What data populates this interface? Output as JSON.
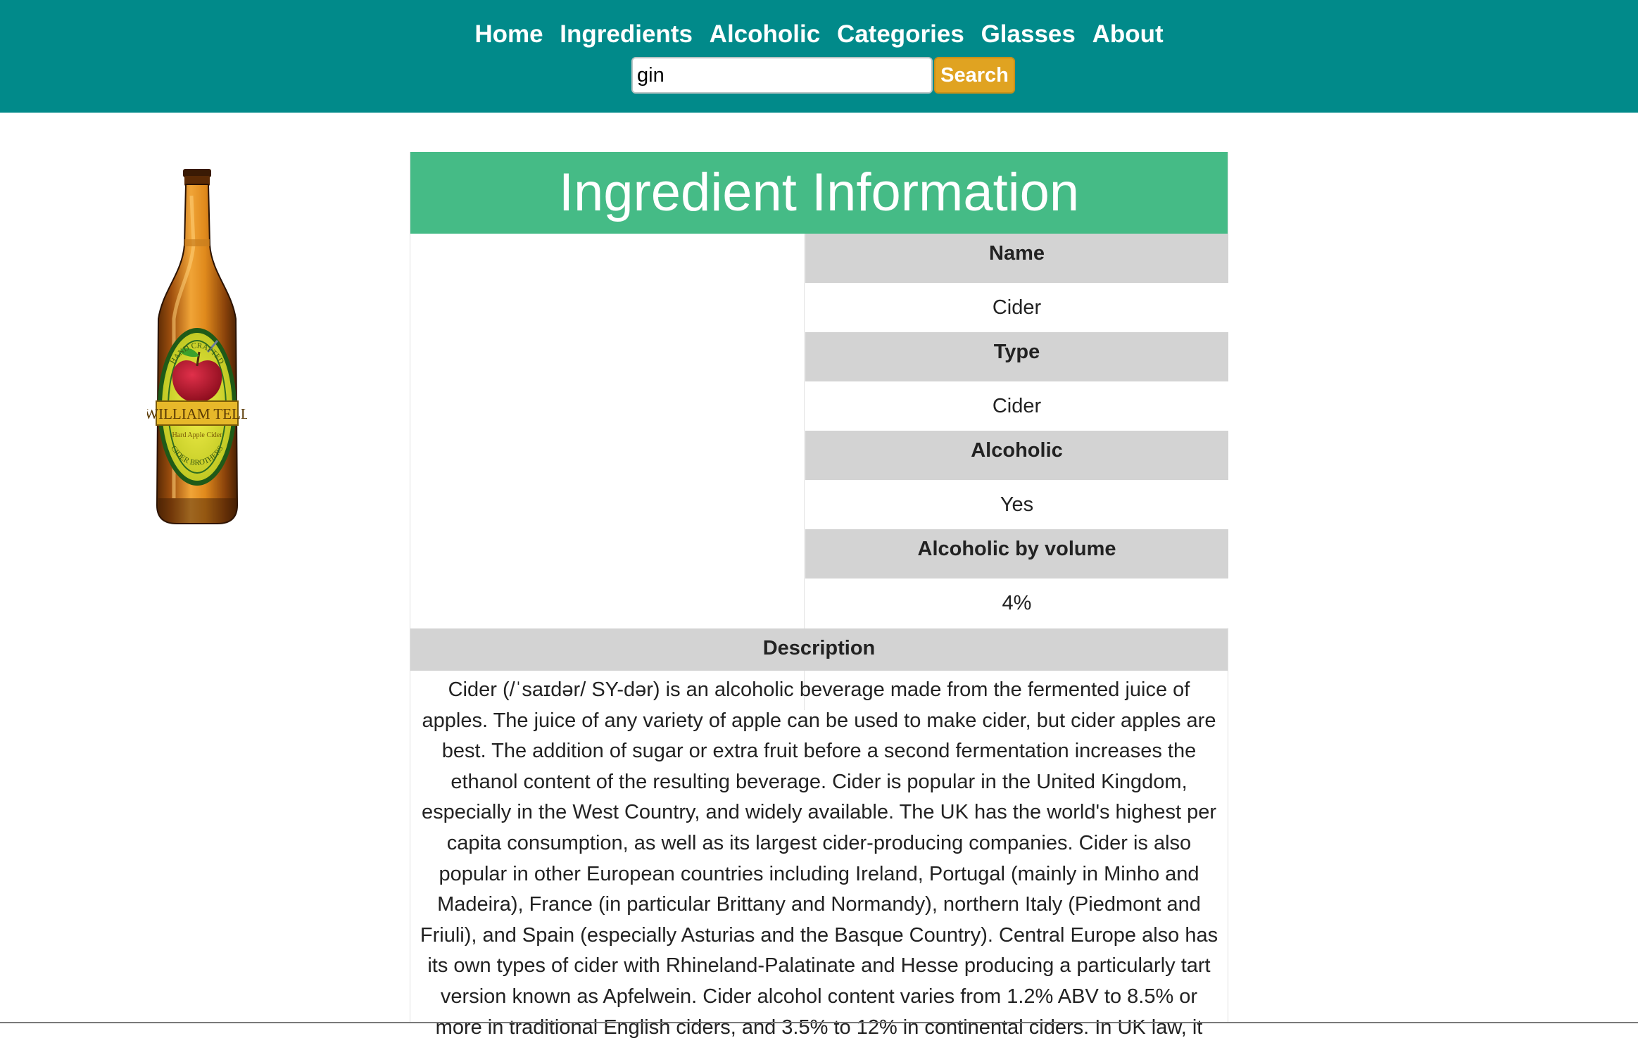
{
  "nav": {
    "items": [
      {
        "label": "Home"
      },
      {
        "label": "Ingredients"
      },
      {
        "label": "Alcoholic"
      },
      {
        "label": "Categories"
      },
      {
        "label": "Glasses"
      },
      {
        "label": "About"
      }
    ]
  },
  "search": {
    "value": "gin",
    "button_label": "Search"
  },
  "panel": {
    "title": "Ingredient Information",
    "image_icon": "cider-bottle-image",
    "fields": [
      {
        "label": "Name",
        "value": "Cider"
      },
      {
        "label": "Type",
        "value": "Cider"
      },
      {
        "label": "Alcoholic",
        "value": "Yes"
      },
      {
        "label": "Alcoholic by volume",
        "value": "4%"
      }
    ],
    "description_label": "Description",
    "description": "Cider (/ˈsaɪdər/ SY-dər) is an alcoholic beverage made from the fermented juice of apples.  The juice of any variety of apple can be used to make cider, but cider apples are best. The addition of sugar or extra fruit before a second fermentation increases the ethanol content of the resulting beverage.  Cider is popular in the United Kingdom, especially in the West Country, and widely available. The UK has the world's highest per capita consumption, as well as its largest cider-producing companies. Cider is also popular in other European countries including Ireland, Portugal (mainly in Minho and Madeira), France (in particular Brittany and Normandy), northern Italy (Piedmont and Friuli), and Spain (especially Asturias and the Basque Country). Central Europe also has its own types of cider with Rhineland-Palatinate and Hesse producing a particularly tart version known as Apfelwein.  Cider alcohol content varies from 1.2% ABV to 8.5% or more in traditional English ciders, and 3.5% to 12% in continental ciders. In UK law, it"
  },
  "bottle_label": {
    "arc_top": "HAND CRAFTED",
    "brand": "WILLIAM TELL",
    "sub": "Hard Apple Cider",
    "arc_bottom": "CIDER BROTHERS"
  },
  "colors": {
    "header": "#018a8a",
    "title_bar": "#45bb86",
    "search_button": "#e0a321",
    "label_row": "#d3d3d3"
  }
}
